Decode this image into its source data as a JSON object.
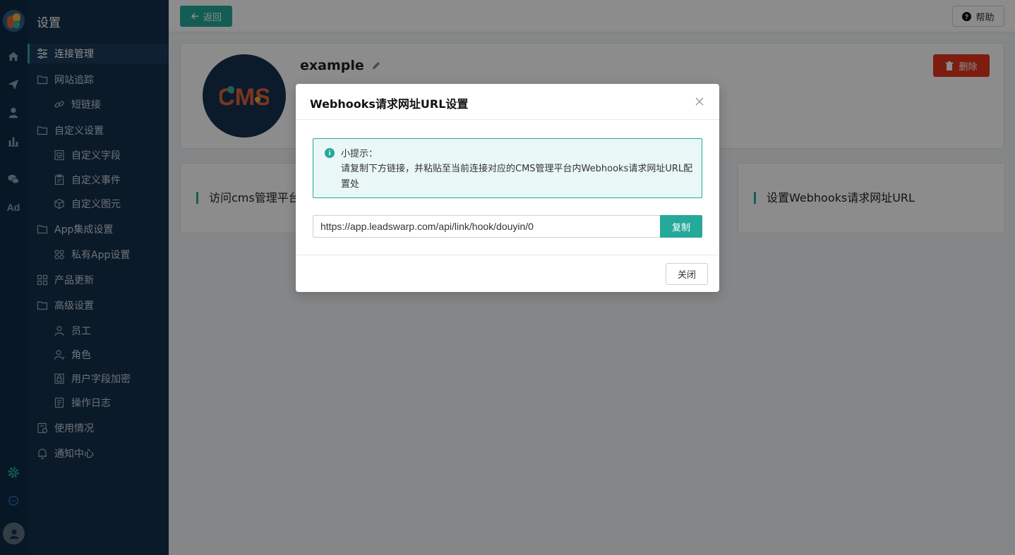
{
  "app": {
    "title": "设置"
  },
  "rail": {
    "items": [
      "home-icon",
      "send-icon",
      "user-icon",
      "chart-icon",
      "wechat-icon",
      "ad-icon",
      "settings-icon",
      "chat-icon",
      "avatar-icon"
    ],
    "ad_label": "Ad"
  },
  "sidebar": {
    "items": [
      {
        "label": "连接管理",
        "icon": "sliders-icon"
      },
      {
        "label": "网站追踪",
        "icon": "folder-icon"
      },
      {
        "label": "短链接",
        "icon": "link-icon"
      },
      {
        "label": "自定义设置",
        "icon": "folder-icon"
      },
      {
        "label": "自定义字段",
        "icon": "field-icon"
      },
      {
        "label": "自定义事件",
        "icon": "clipboard-icon"
      },
      {
        "label": "自定义图元",
        "icon": "cube-icon"
      },
      {
        "label": "App集成设置",
        "icon": "folder-icon"
      },
      {
        "label": "私有App设置",
        "icon": "grid-icon"
      },
      {
        "label": "产品更新",
        "icon": "apps-icon"
      },
      {
        "label": "高级设置",
        "icon": "folder-icon"
      },
      {
        "label": "员工",
        "icon": "person-icon"
      },
      {
        "label": "角色",
        "icon": "role-icon"
      },
      {
        "label": "用户字段加密",
        "icon": "lock-doc-icon"
      },
      {
        "label": "操作日志",
        "icon": "log-icon"
      },
      {
        "label": "使用情况",
        "icon": "usage-icon"
      },
      {
        "label": "通知中心",
        "icon": "bell-icon"
      }
    ]
  },
  "toolbar": {
    "back_label": "返回",
    "help_label": "帮助"
  },
  "connection": {
    "name": "example",
    "delete_label": "删除",
    "logo_text": "CMS"
  },
  "steps": [
    {
      "label": "访问cms管理平台"
    },
    {
      "label": "设置Webhooks请求网址URL"
    }
  ],
  "modal": {
    "title": "Webhooks请求网址URL设置",
    "tip_title": "小提示：",
    "tip_text": "请复制下方链接，并粘贴至当前连接对应的CMS管理平台内Webhooks请求网址URL配置处",
    "url_value": "https://app.leadswarp.com/api/link/hook/douyin/0",
    "copy_label": "复制",
    "close_label": "关闭"
  },
  "colors": {
    "accent": "#25a99a",
    "danger": "#e2361c",
    "sidebar_bg": "#14304c",
    "rail_bg": "#0f2a44"
  }
}
